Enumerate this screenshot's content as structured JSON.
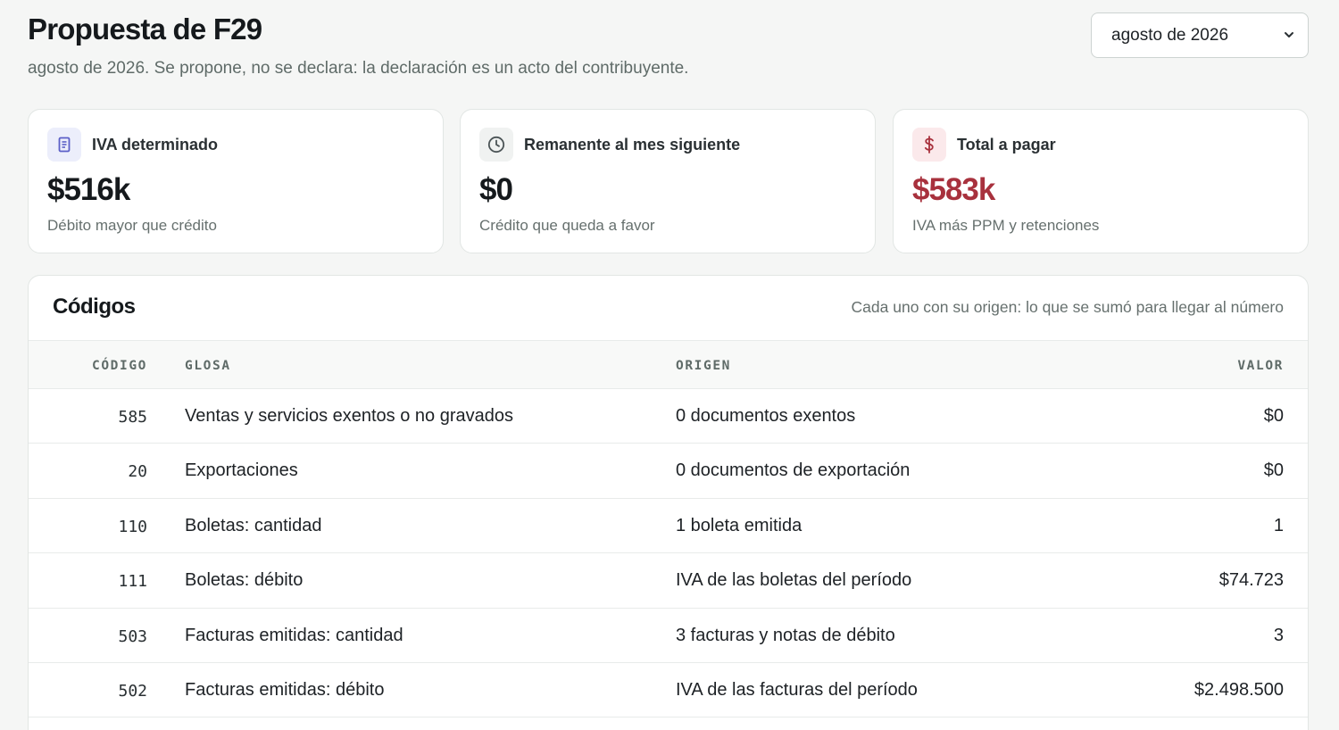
{
  "header": {
    "title": "Propuesta de F29",
    "subtitle": "agosto de 2026. Se propone, no se declara: la declaración es un acto del contribuyente.",
    "period_select": "agosto de 2026"
  },
  "cards": [
    {
      "icon": "document-icon",
      "label": "IVA determinado",
      "value": "$516k",
      "hint": "Débito mayor que crédito",
      "accent": "#5b5fc7"
    },
    {
      "icon": "clock-icon",
      "label": "Remanente al mes siguiente",
      "value": "$0",
      "hint": "Crédito que queda a favor",
      "accent": "#4b5456"
    },
    {
      "icon": "dollar-icon",
      "label": "Total a pagar",
      "value": "$583k",
      "hint": "IVA más PPM y retenciones",
      "accent": "#a8313d"
    }
  ],
  "codes_panel": {
    "title": "Códigos",
    "note": "Cada uno con su origen: lo que se sumó para llegar al número",
    "columns": {
      "code": "CÓDIGO",
      "glosa": "GLOSA",
      "origen": "ORIGEN",
      "valor": "VALOR"
    },
    "rows": [
      {
        "code": "585",
        "glosa": "Ventas y servicios exentos o no gravados",
        "origen": "0 documentos exentos",
        "valor": "$0"
      },
      {
        "code": "20",
        "glosa": "Exportaciones",
        "origen": "0 documentos de exportación",
        "valor": "$0"
      },
      {
        "code": "110",
        "glosa": "Boletas: cantidad",
        "origen": "1 boleta emitida",
        "valor": "1"
      },
      {
        "code": "111",
        "glosa": "Boletas: débito",
        "origen": "IVA de las boletas del período",
        "valor": "$74.723"
      },
      {
        "code": "503",
        "glosa": "Facturas emitidas: cantidad",
        "origen": "3 facturas y notas de débito",
        "valor": "3"
      },
      {
        "code": "502",
        "glosa": "Facturas emitidas: débito",
        "origen": "IVA de las facturas del período",
        "valor": "$2.498.500"
      }
    ]
  }
}
